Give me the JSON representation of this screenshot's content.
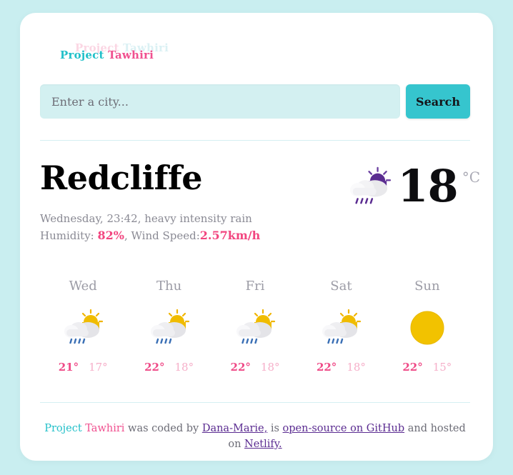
{
  "theme": {
    "page_background": "#c9eef0",
    "card_background": "#ffffff",
    "accent_teal": "#23c0c9",
    "accent_pink": "#f0508f",
    "button_teal": "#36c5ce",
    "input_background": "#d3f0f1",
    "divider": "#d5eff2",
    "link_purple": "#5b2c91",
    "muted_text": "#8a8a94"
  },
  "logo": {
    "ghost": {
      "project": "Project",
      "tawhiri": "Tawhiri"
    },
    "main": {
      "project": "Project",
      "tawhiri": "Tawhiri"
    }
  },
  "search": {
    "placeholder": "Enter a city...",
    "value": "",
    "button_label": "Search"
  },
  "current": {
    "city": "Redcliffe",
    "datetime": "Wednesday, 23:42, heavy intensity rain",
    "humidity_label": "Humidity: ",
    "humidity_value": "82%",
    "wind_separator": ", Wind Speed:",
    "wind_value": "2.57km/h",
    "temperature": "18",
    "unit": "°C",
    "icon": "sun-behind-rain-cloud-purple-icon"
  },
  "forecast": [
    {
      "day": "Wed",
      "icon": "sun-behind-rain-cloud-icon",
      "max": "21°",
      "min": "17°"
    },
    {
      "day": "Thu",
      "icon": "sun-behind-rain-cloud-icon",
      "max": "22°",
      "min": "18°"
    },
    {
      "day": "Fri",
      "icon": "sun-behind-rain-cloud-icon",
      "max": "22°",
      "min": "18°"
    },
    {
      "day": "Sat",
      "icon": "sun-behind-rain-cloud-icon",
      "max": "22°",
      "min": "18°"
    },
    {
      "day": "Sun",
      "icon": "clear-sun-icon",
      "max": "22°",
      "min": "15°"
    }
  ],
  "footer": {
    "brand_project": "Project",
    "brand_tawhiri": "Tawhiri",
    "text_1": " was coded by ",
    "link_author": "Dana-Marie,",
    "text_2": " is ",
    "link_github": "open-source on GitHub",
    "text_3": " and hosted on ",
    "link_host": "Netlify."
  }
}
